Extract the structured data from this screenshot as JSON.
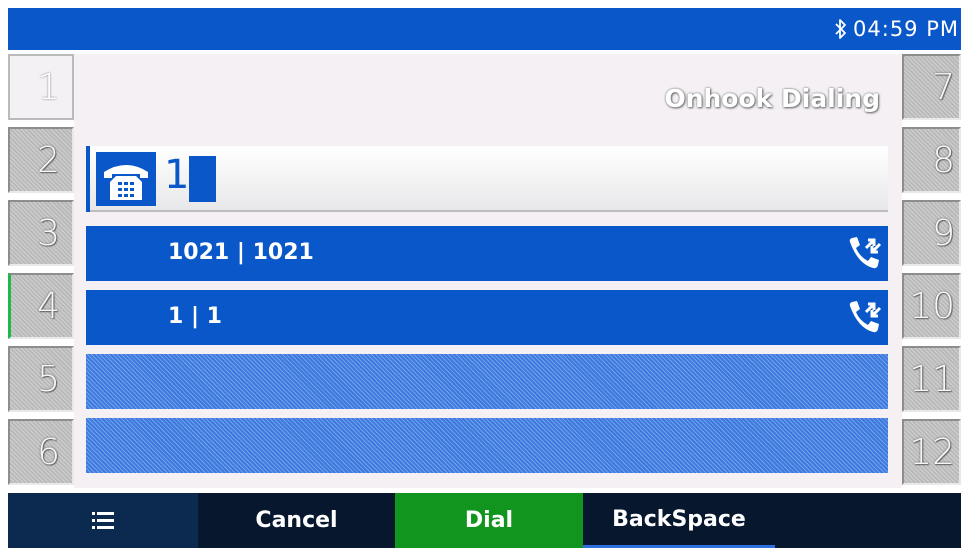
{
  "status_bar": {
    "time": "04:59 PM",
    "bluetooth_icon": "bluetooth-icon",
    "color": "#0a57c9"
  },
  "line_keys_left": [
    "1",
    "2",
    "3",
    "4",
    "5",
    "6"
  ],
  "line_keys_right": [
    "7",
    "8",
    "9",
    "10",
    "11",
    "12"
  ],
  "screen": {
    "title": "Onhook Dialing",
    "dial_input": {
      "value": "1",
      "icon": "phone-icon"
    },
    "suggestions": [
      {
        "text": "1021 | 1021",
        "icon": "call-history-icon"
      },
      {
        "text": "1 | 1",
        "icon": "call-history-icon"
      }
    ]
  },
  "softkeys": {
    "menu_icon": "menu-icon",
    "cancel": "Cancel",
    "dial": "Dial",
    "backspace": "BackSpace"
  },
  "colors": {
    "accent_blue": "#0a57c9",
    "dial_green": "#12951f",
    "softbar": "#06172e"
  }
}
